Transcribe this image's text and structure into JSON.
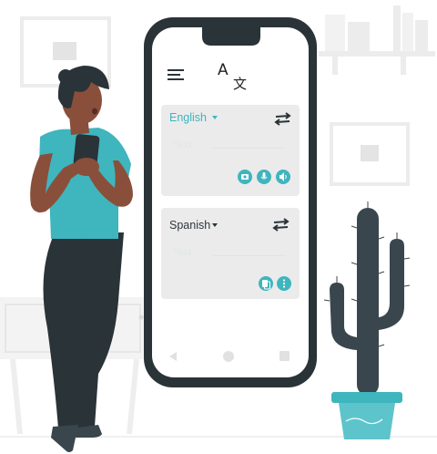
{
  "colors": {
    "accent": "#3fb5be",
    "phone_frame": "#2a3338",
    "panel": "#ebebeb",
    "shirt": "#3fb5be",
    "cactus": "#3a464d",
    "pot": "#3fb5be",
    "decor": "#ededed"
  },
  "app": {
    "logo_a": "A",
    "logo_b": "文",
    "menu_icon": "menu-icon"
  },
  "source": {
    "language": "English",
    "placeholder": "Text",
    "dropdown_icon": "caret-down-icon",
    "swap_icon": "swap-arrows-icon",
    "actions": [
      "camera-icon",
      "microphone-icon",
      "speaker-icon"
    ]
  },
  "target": {
    "language": "Spanish",
    "placeholder": "Text",
    "dropdown_icon": "caret-down-icon",
    "swap_icon": "swap-arrows-icon",
    "actions": [
      "copy-icon",
      "more-icon"
    ]
  },
  "navbar": [
    "back-icon",
    "home-icon",
    "recents-icon"
  ]
}
